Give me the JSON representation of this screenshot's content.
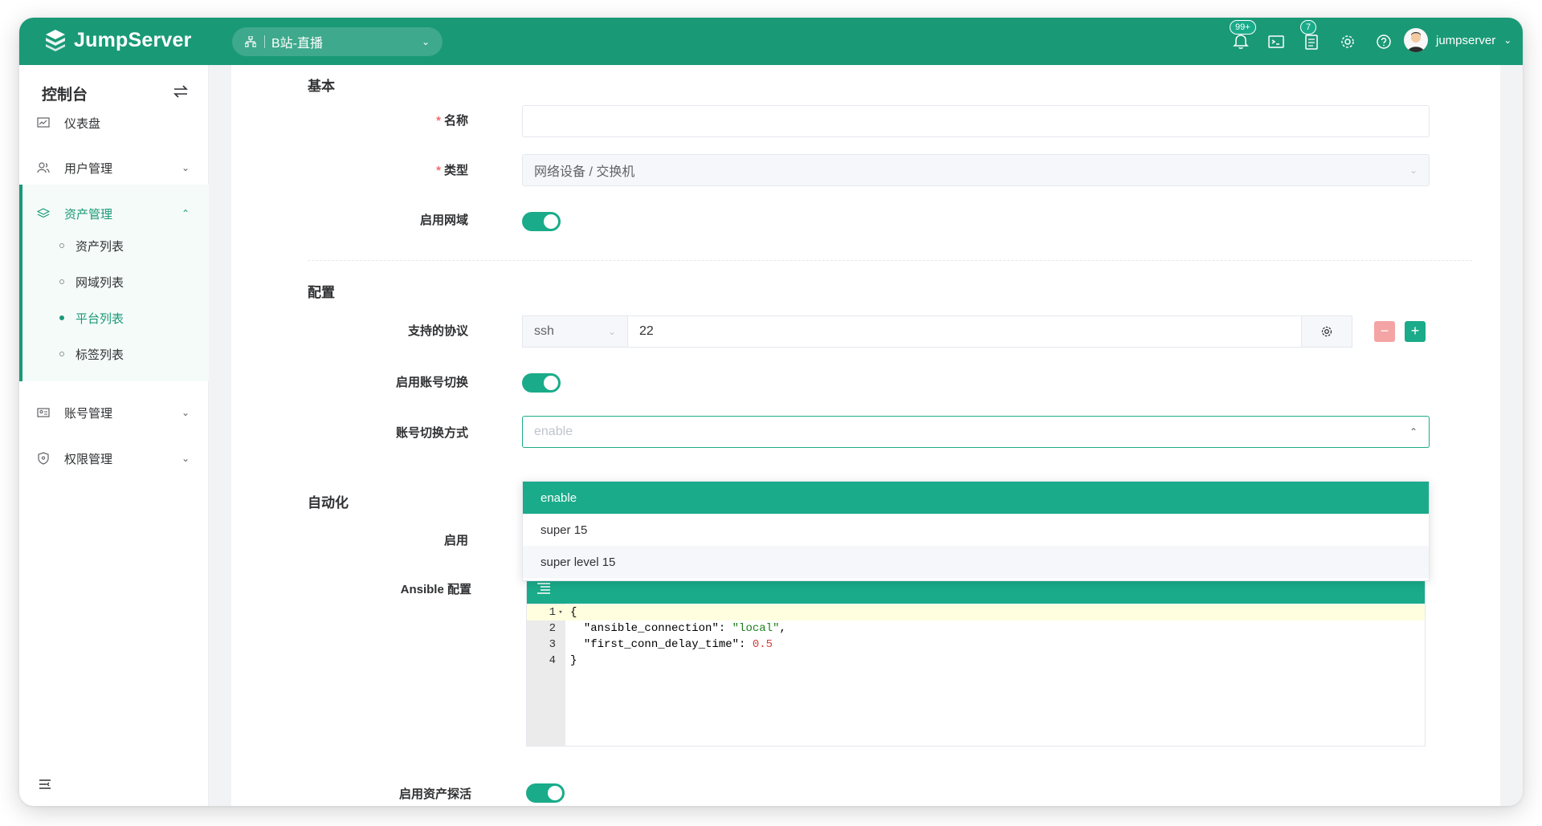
{
  "app": {
    "name": "JumpServer"
  },
  "topbar": {
    "org": "B站-直播",
    "notifications_badge": "99+",
    "tickets_badge": "7",
    "username": "jumpserver"
  },
  "sidebar": {
    "title": "控制台",
    "items": [
      {
        "label": "仪表盘"
      },
      {
        "label": "用户管理"
      },
      {
        "label": "资产管理"
      },
      {
        "label": "账号管理"
      },
      {
        "label": "权限管理"
      }
    ],
    "sub_items": [
      {
        "label": "资产列表"
      },
      {
        "label": "网域列表"
      },
      {
        "label": "平台列表"
      },
      {
        "label": "标签列表"
      }
    ]
  },
  "form": {
    "section_basic": "基本",
    "name_label": "名称",
    "name_value": "",
    "type_label": "类型",
    "type_value": "网络设备 / 交换机",
    "gateway_label": "启用网域",
    "section_config": "配置",
    "protocol_label": "支持的协议",
    "protocol_name": "ssh",
    "protocol_port": "22",
    "su_enable_label": "启用账号切换",
    "su_method_label": "账号切换方式",
    "su_method_placeholder": "enable",
    "section_auto": "自动化",
    "auto_enable_label": "启用",
    "ansible_label": "Ansible 配置",
    "ping_label": "启用资产探活"
  },
  "dropdown": {
    "options": [
      "enable",
      "super 15",
      "super level 15"
    ],
    "selected": "enable"
  },
  "editor": {
    "lines": [
      "1",
      "2",
      "3",
      "4"
    ],
    "l1": "{",
    "l2_key": "\"ansible_connection\"",
    "l2_val": "\"local\"",
    "l3_key": "\"first_conn_delay_time\"",
    "l3_val": "0.5",
    "l4": "}"
  },
  "colors": {
    "brand": "#1a9977",
    "accent": "#1aab8a",
    "danger": "#f4a4a4"
  }
}
